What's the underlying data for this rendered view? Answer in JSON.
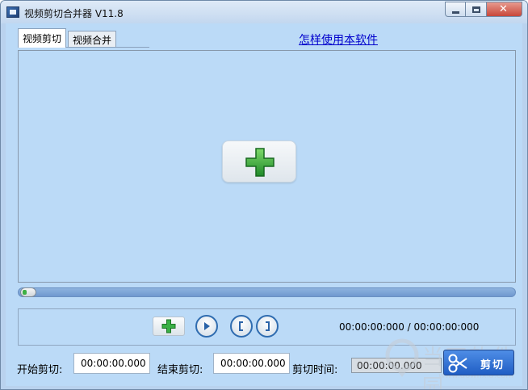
{
  "window": {
    "title": "视频剪切合并器 V11.8",
    "close_label": "✕"
  },
  "tabs": [
    {
      "label": "视频剪切",
      "active": true
    },
    {
      "label": "视频合并",
      "active": false
    }
  ],
  "help_link": "怎样使用本软件",
  "player": {
    "progress": 0.0,
    "time_display": "00:00:00:000 / 00:00:00:000"
  },
  "icons": {
    "add_media": "plus-icon",
    "add_file": "plus-icon",
    "play": "play-icon",
    "mark_in": "bracket-left-icon",
    "mark_out": "bracket-right-icon",
    "cut": "scissors-icon"
  },
  "fields": {
    "start_label": "开始剪切:",
    "start_value": "00:00:00.000",
    "end_label": "结束剪切:",
    "end_value": "00:00:00.000",
    "duration_label": "剪切时间:",
    "duration_value": "00:00:00.000"
  },
  "cut_button_label": "剪切",
  "watermark": {
    "title": "当下软件园",
    "url": "www.downxia.com"
  },
  "colors": {
    "client_bg": "#bbdaf7",
    "link": "#0000cc",
    "accent_green": "#2fa33a",
    "button_blue": "#1f5dc4"
  }
}
